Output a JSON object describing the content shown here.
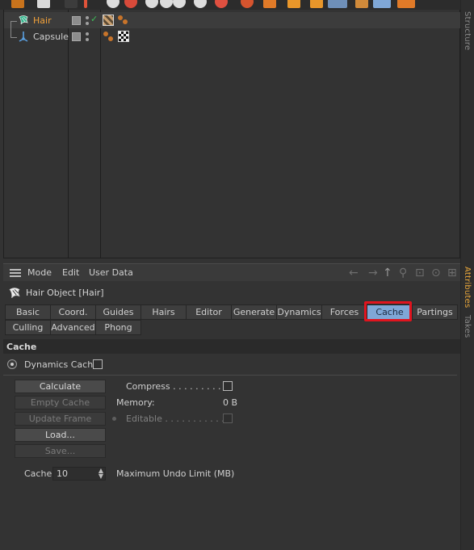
{
  "objects": [
    {
      "name": "Hair"
    },
    {
      "name": "Capsule"
    }
  ],
  "side_tabs": {
    "structure": "Structure",
    "attributes": "Attributes",
    "takes": "Takes"
  },
  "attr_menu": {
    "mode": "Mode",
    "edit": "Edit",
    "user_data": "User Data"
  },
  "object_title": "Hair Object [Hair]",
  "tabs_row1": [
    "Basic",
    "Coord.",
    "Guides",
    "Hairs",
    "Editor",
    "Generate",
    "Dynamics",
    "Forces",
    "Cache",
    "Partings"
  ],
  "tabs_row2": [
    "Culling",
    "Advanced",
    "Phong"
  ],
  "active_tab": "Cache",
  "section_title": "Cache",
  "dynamics_cache_label": "Dynamics Cache",
  "buttons": {
    "calculate": "Calculate",
    "empty_cache": "Empty Cache",
    "update_frame": "Update Frame",
    "load": "Load...",
    "save": "Save..."
  },
  "fields": {
    "compress_label": "Compress . . . . . . . . .",
    "memory_label": "Memory:",
    "memory_value": "0 B",
    "editable_label": "Editable . . . . . . . . . . .",
    "cache_label": "Cache",
    "cache_value": "10",
    "undo_limit_label": "Maximum Undo Limit (MB)"
  },
  "colors": {
    "accent_orange": "#f2a23a",
    "active_tab_blue": "#7fa7d6",
    "highlight_red": "#e0141e"
  }
}
